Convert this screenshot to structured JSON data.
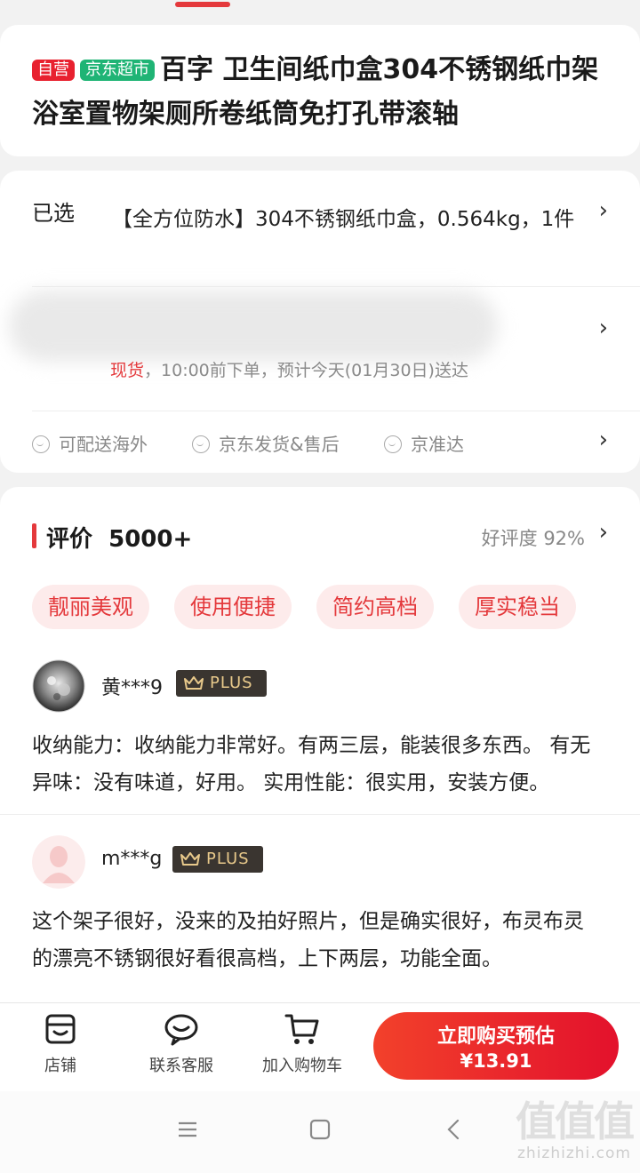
{
  "product": {
    "tag_self": "自营",
    "tag_store": "京东超市",
    "title": "百字 卫生间纸巾盒304不锈钢纸巾架浴室置物架厕所卷纸筒免打孔带滚轴"
  },
  "spec": {
    "selected_label": "已选",
    "selected_value": "【全方位防水】304不锈钢纸巾盒，0.564kg，1件",
    "stock": "现货",
    "delivery_text": "，10:00前下单，预计今天(01月30日)送达",
    "services": [
      "可配送海外",
      "京东发货&售后",
      "京准达"
    ]
  },
  "reviews": {
    "title": "评价",
    "count": "5000+",
    "rate": "好评度 92%",
    "chips": [
      "靓丽美观",
      "使用便捷",
      "简约高档",
      "厚实稳当"
    ],
    "plus_label": "PLUS",
    "items": [
      {
        "user": "黄***9",
        "text": "收纳能力：收纳能力非常好。有两三层，能装很多东西。 有无异味：没有味道，好用。 实用性能：很实用，安装方便。"
      },
      {
        "user": "m***g",
        "text": "这个架子很好，没来的及拍好照片，但是确实很好，布灵布灵的漂亮不锈钢很好看很高档，上下两层，功能全面。"
      }
    ]
  },
  "bottom_bar": {
    "store": "店铺",
    "service": "联系客服",
    "cart": "加入购物车",
    "buy_label": "立即购买预估",
    "buy_price": "¥13.91"
  },
  "watermark": {
    "logo": "值值值",
    "url": "zhizhizhi.com"
  },
  "colors": {
    "accent": "#e4393c",
    "green_tag": "#1fb475",
    "chip_bg": "#fdebeb",
    "plus_bg": "#3a3530",
    "plus_text": "#e8c98b"
  }
}
